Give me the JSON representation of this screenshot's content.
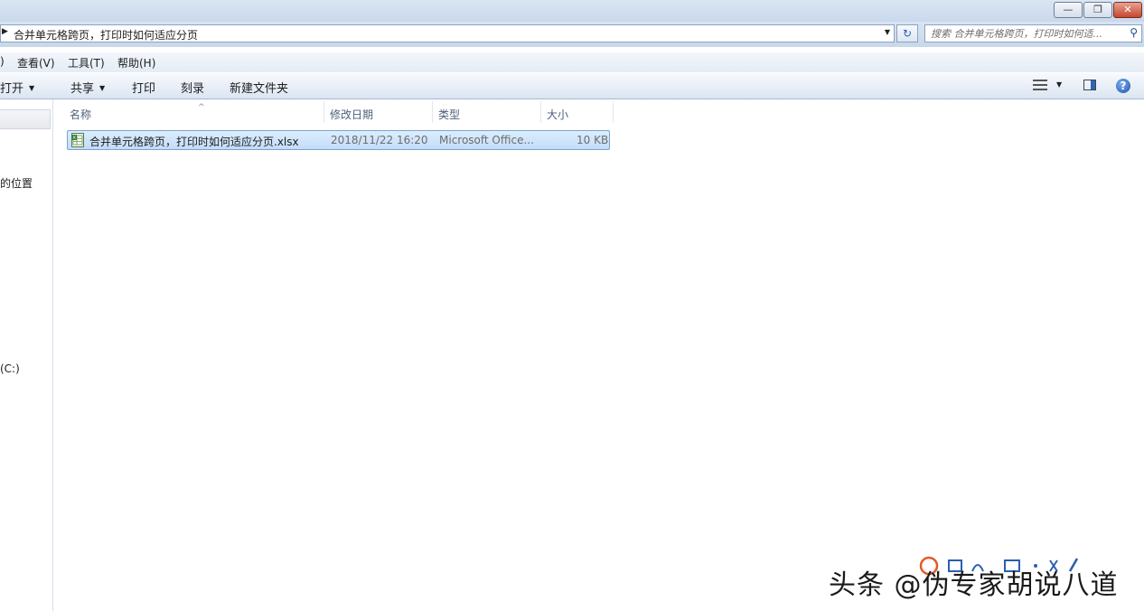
{
  "window": {
    "minimize_glyph": "—",
    "restore_glyph": "❐",
    "close_glyph": "✕"
  },
  "address": {
    "path": "合并单元格跨页，打印时如何适应分页",
    "refresh_glyph": "↻"
  },
  "search": {
    "placeholder": "搜索 合并单元格跨页，打印时如何适..."
  },
  "menu": {
    "partial": ")",
    "view": "查看(V)",
    "tools": "工具(T)",
    "help": "帮助(H)"
  },
  "toolbar": {
    "open": "打开",
    "share": "共享",
    "print": "打印",
    "burn": "刻录",
    "new_folder": "新建文件夹"
  },
  "nav": {
    "locations": "的位置",
    "drive_c": "(C:)"
  },
  "columns": {
    "name": "名称",
    "modified": "修改日期",
    "type": "类型",
    "size": "大小"
  },
  "files": [
    {
      "name": "合并单元格跨页，打印时如何适应分页.xlsx",
      "modified": "2018/11/22 16:20",
      "type": "Microsoft Office...",
      "size": "10 KB"
    }
  ],
  "watermark": {
    "text": "头条 @伪专家胡说八道"
  },
  "colors": {
    "selection": "#c3dcf8",
    "accent": "#2d64b8"
  }
}
